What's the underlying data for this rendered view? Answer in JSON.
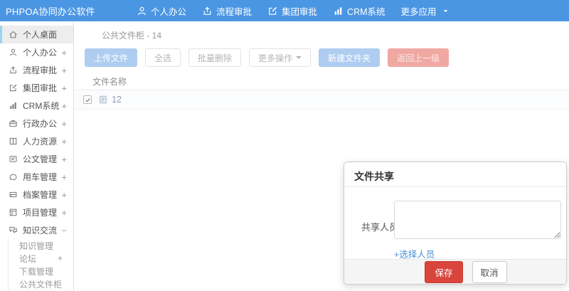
{
  "topbar": {
    "brand": "PHPOA协同办公软件",
    "nav": [
      {
        "label": "个人办公",
        "icon": "user-icon"
      },
      {
        "label": "流程审批",
        "icon": "share-icon"
      },
      {
        "label": "集团审批",
        "icon": "edit-icon"
      },
      {
        "label": "CRM系统",
        "icon": "chart-icon"
      },
      {
        "label": "更多应用",
        "icon": "",
        "caret": true
      }
    ]
  },
  "sidebar": {
    "items": [
      {
        "label": "个人桌面",
        "icon": "home-icon",
        "active": true,
        "expand": ""
      },
      {
        "label": "个人办公",
        "icon": "user-icon",
        "expand": "+"
      },
      {
        "label": "流程审批",
        "icon": "share-icon",
        "expand": "+"
      },
      {
        "label": "集团审批",
        "icon": "edit-icon",
        "expand": "+"
      },
      {
        "label": "CRM系统",
        "icon": "chart-icon",
        "expand": "+"
      },
      {
        "label": "行政办公",
        "icon": "briefcase-icon",
        "expand": "+"
      },
      {
        "label": "人力资源",
        "icon": "book-icon",
        "expand": "+"
      },
      {
        "label": "公文管理",
        "icon": "document-icon",
        "expand": "+"
      },
      {
        "label": "用车管理",
        "icon": "car-icon",
        "expand": "+"
      },
      {
        "label": "档案管理",
        "icon": "archive-icon",
        "expand": "+"
      },
      {
        "label": "项目管理",
        "icon": "project-icon",
        "expand": "+"
      },
      {
        "label": "知识交流",
        "icon": "chat-icon",
        "expand": "−",
        "children": [
          {
            "label": "知识管理",
            "expand": ""
          },
          {
            "label": "论坛",
            "expand": "+"
          },
          {
            "label": "下载管理",
            "expand": ""
          },
          {
            "label": "公共文件柜",
            "expand": ""
          }
        ]
      }
    ]
  },
  "main": {
    "breadcrumb": {
      "icon": "folder-icon",
      "text": "公共文件柜 - 14"
    },
    "toolbar": [
      {
        "label": "上传文件",
        "style": "primary"
      },
      {
        "label": "全选",
        "style": "default"
      },
      {
        "label": "批量删除",
        "style": "default"
      },
      {
        "label": "更多操作",
        "style": "default",
        "caret": true
      },
      {
        "label": "新建文件夹",
        "style": "primary"
      },
      {
        "label": "返回上一级",
        "style": "danger"
      }
    ],
    "table": {
      "header": "文件名称",
      "rows": [
        {
          "name": "12",
          "checked": true,
          "icon": "file-icon"
        }
      ]
    }
  },
  "modal": {
    "title": "文件共享",
    "field_label": "共享人员",
    "textarea_value": "",
    "select_link": "+选择人员",
    "save_label": "保存",
    "cancel_label": "取消"
  },
  "colors": {
    "topbar_blue": "#4b96e3",
    "primary_light_blue": "#aecdf0",
    "danger_light_red": "#f0a8a3",
    "save_red": "#d9453c",
    "link_blue": "#4a90d9",
    "active_item_border": "#9bd3ef",
    "breadcrumb_folder": "#edc87e"
  }
}
